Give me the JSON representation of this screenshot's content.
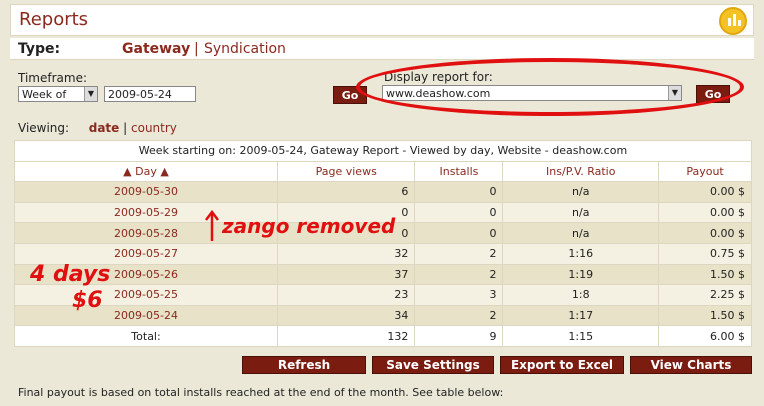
{
  "header": {
    "title": "Reports",
    "icon": "bar-chart-icon"
  },
  "type_row": {
    "label": "Type:",
    "gateway": "Gateway",
    "separator": "|",
    "syndication": "Syndication"
  },
  "timeframe": {
    "label": "Timeframe:",
    "period": "Week of",
    "date": "2009-05-24",
    "go": "Go"
  },
  "display": {
    "label": "Display report for:",
    "site": "www.deashow.com",
    "go": "Go"
  },
  "viewing": {
    "label": "Viewing:",
    "date": "date",
    "separator": "|",
    "country": "country"
  },
  "table": {
    "caption": "Week starting on: 2009-05-24, Gateway Report - Viewed by day, Website - deashow.com",
    "headers": [
      "Day",
      "Page views",
      "Installs",
      "Ins/P.V. Ratio",
      "Payout"
    ],
    "rows": [
      {
        "day": "2009-05-30",
        "views": "6",
        "installs": "0",
        "ratio": "n/a",
        "payout": "0.00 $"
      },
      {
        "day": "2009-05-29",
        "views": "0",
        "installs": "0",
        "ratio": "n/a",
        "payout": "0.00 $"
      },
      {
        "day": "2009-05-28",
        "views": "0",
        "installs": "0",
        "ratio": "n/a",
        "payout": "0.00 $"
      },
      {
        "day": "2009-05-27",
        "views": "32",
        "installs": "2",
        "ratio": "1:16",
        "payout": "0.75 $"
      },
      {
        "day": "2009-05-26",
        "views": "37",
        "installs": "2",
        "ratio": "1:19",
        "payout": "1.50 $"
      },
      {
        "day": "2009-05-25",
        "views": "23",
        "installs": "3",
        "ratio": "1:8",
        "payout": "2.25 $"
      },
      {
        "day": "2009-05-24",
        "views": "34",
        "installs": "2",
        "ratio": "1:17",
        "payout": "1.50 $"
      }
    ],
    "total": {
      "label": "Total:",
      "views": "132",
      "installs": "9",
      "ratio": "1:15",
      "payout": "6.00 $"
    }
  },
  "annotations": {
    "zango": "zango removed",
    "days": "4 days",
    "amount": "$6",
    "arrow": "up-arrow-icon"
  },
  "buttons": {
    "refresh": "Refresh",
    "save": "Save Settings",
    "export": "Export to Excel",
    "charts": "View Charts"
  },
  "footnote": "Final payout is based on total installs reached at the end of the month. See table below:",
  "colors": {
    "accent": "#8a2a1e",
    "button": "#7a1c10",
    "annotation": "#e01010",
    "background": "#ece8d8"
  }
}
